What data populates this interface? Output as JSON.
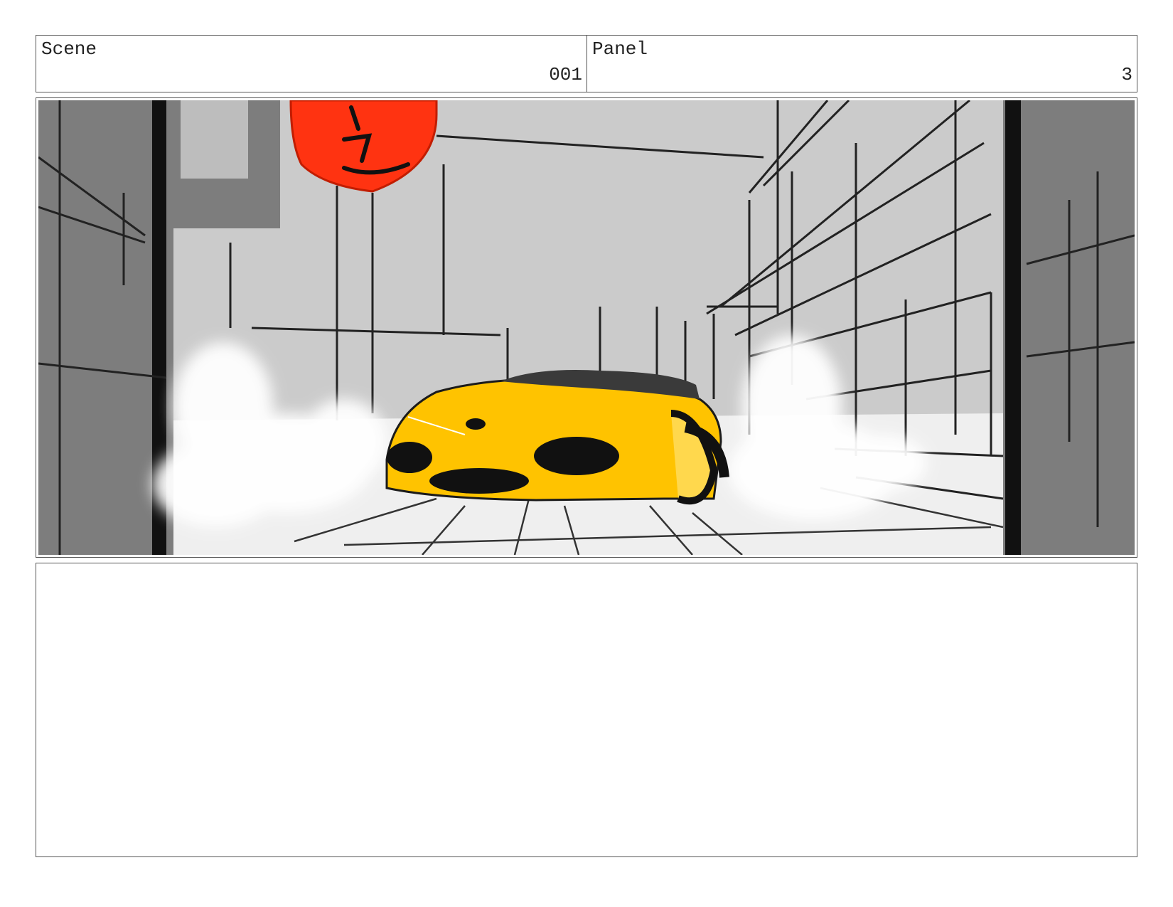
{
  "header": {
    "scene_label": "Scene",
    "scene_number": "001",
    "panel_label": "Panel",
    "panel_number": "3"
  },
  "illustration": {
    "subject": "yellow sports car drifting through city street with tire smoke",
    "colors": {
      "car": "#ffc300",
      "lantern": "#ff3311",
      "sky": "#cbcbcb",
      "walls": "#7d7d7d",
      "ink": "#1b1b1b"
    }
  },
  "notes": {
    "text": ""
  }
}
